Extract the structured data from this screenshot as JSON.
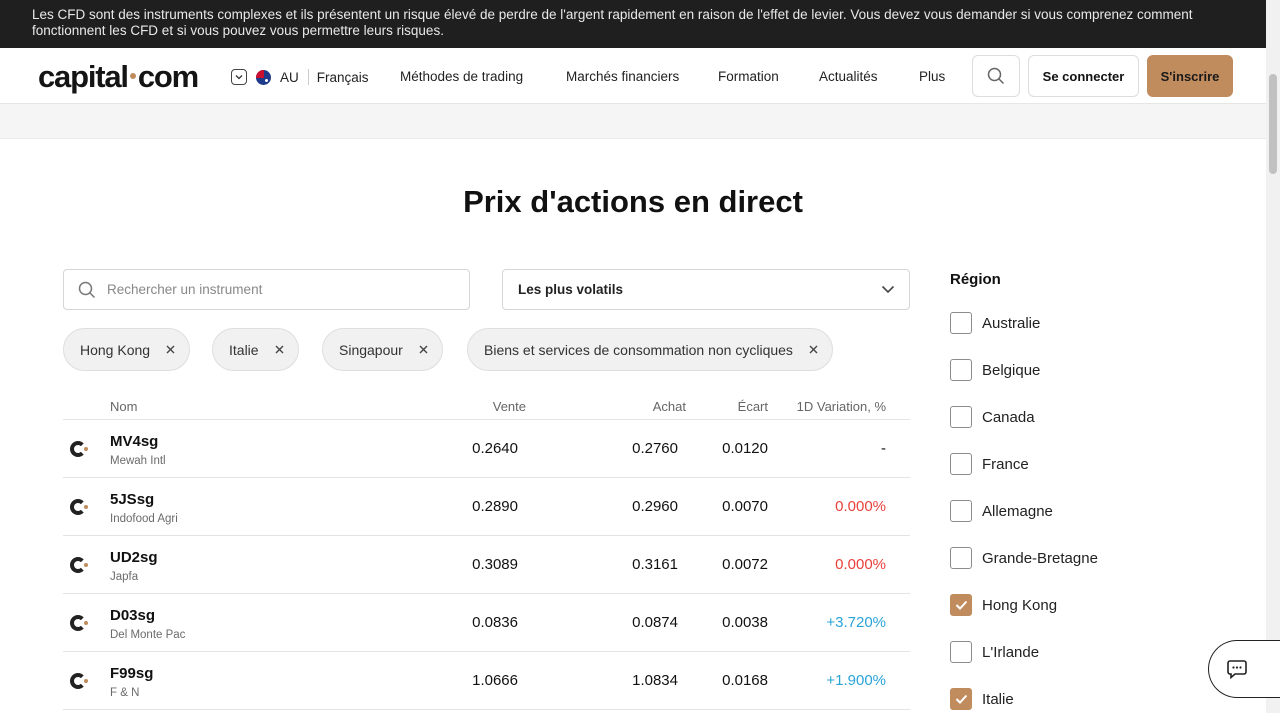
{
  "risk_warning": "Les CFD sont des instruments complexes et ils présentent un risque élevé de perdre de l'argent rapidement en raison de l'effet de levier. Vous devez vous demander si vous comprenez comment fonctionnent les CFD et si vous pouvez vous permettre leurs risques.",
  "header": {
    "logo_left": "capital",
    "logo_right": "com",
    "region_code": "AU",
    "language": "Français",
    "nav": [
      "Méthodes de trading",
      "Marchés financiers",
      "Formation",
      "Actualités",
      "Plus"
    ],
    "login_label": "Se connecter",
    "signup_label": "S'inscrire"
  },
  "page_title": "Prix d'actions en direct",
  "search": {
    "placeholder": "Rechercher un instrument",
    "value": ""
  },
  "sort": {
    "selected": "Les plus volatils"
  },
  "chips": [
    "Hong Kong",
    "Italie",
    "Singapour",
    "Biens et services de consommation non cycliques"
  ],
  "table": {
    "headers": {
      "name": "Nom",
      "sell": "Vente",
      "buy": "Achat",
      "spread": "Écart",
      "change": "1D Variation, %"
    },
    "rows": [
      {
        "symbol": "MV4sg",
        "company": "Mewah Intl",
        "sell": "0.2640",
        "buy": "0.2760",
        "spread": "0.0120",
        "change": "-"
      },
      {
        "symbol": "5JSsg",
        "company": "Indofood Agri",
        "sell": "0.2890",
        "buy": "0.2960",
        "spread": "0.0070",
        "change": "0.000%"
      },
      {
        "symbol": "UD2sg",
        "company": "Japfa",
        "sell": "0.3089",
        "buy": "0.3161",
        "spread": "0.0072",
        "change": "0.000%"
      },
      {
        "symbol": "D03sg",
        "company": "Del Monte Pac",
        "sell": "0.0836",
        "buy": "0.0874",
        "spread": "0.0038",
        "change": "+3.720%"
      },
      {
        "symbol": "F99sg",
        "company": "F & N",
        "sell": "1.0666",
        "buy": "1.0834",
        "spread": "0.0168",
        "change": "+1.900%"
      }
    ]
  },
  "region_filter": {
    "title": "Région",
    "items": [
      {
        "label": "Australie",
        "checked": false
      },
      {
        "label": "Belgique",
        "checked": false
      },
      {
        "label": "Canada",
        "checked": false
      },
      {
        "label": "France",
        "checked": false
      },
      {
        "label": "Allemagne",
        "checked": false
      },
      {
        "label": "Grande-Bretagne",
        "checked": false
      },
      {
        "label": "Hong Kong",
        "checked": true
      },
      {
        "label": "L'Irlande",
        "checked": false
      },
      {
        "label": "Italie",
        "checked": true
      }
    ]
  },
  "colors": {
    "accent": "#c18c5d",
    "negative": "#e8413b",
    "positive": "#2aa4d8",
    "banner_bg": "#1f1f1f"
  }
}
